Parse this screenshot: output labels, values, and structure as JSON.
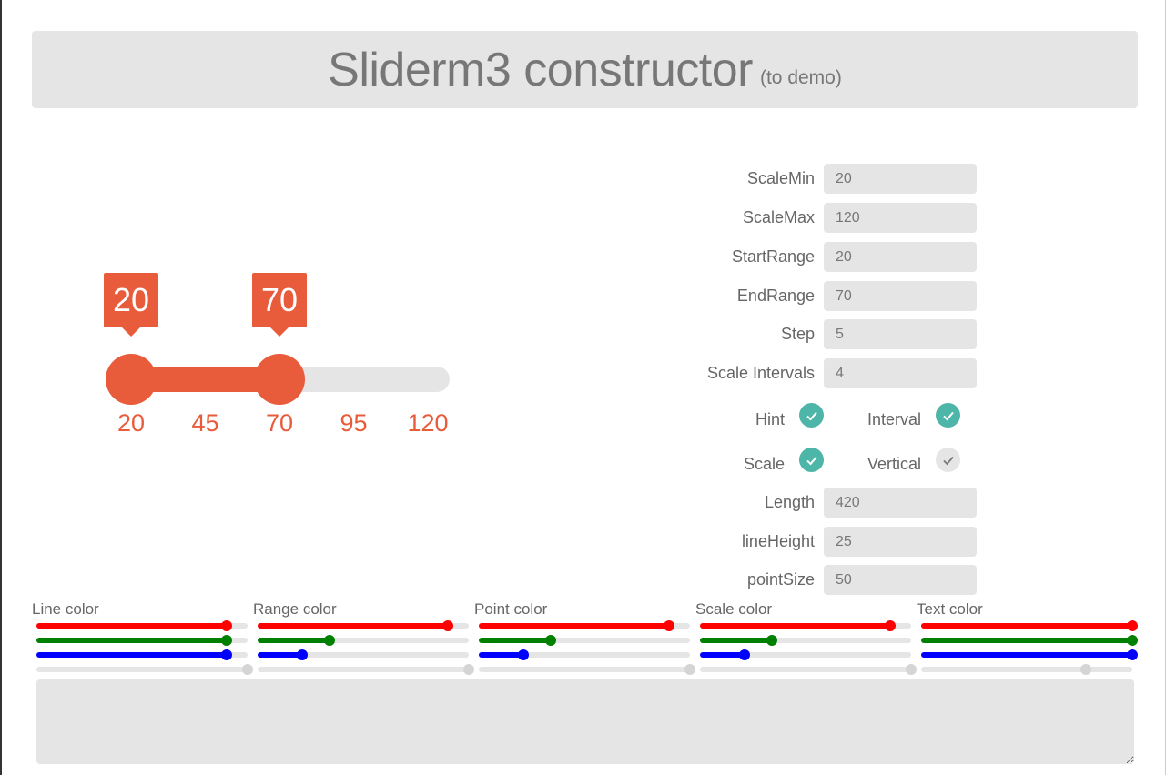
{
  "header": {
    "title": "Sliderm3 constructor",
    "subtitle": "(to demo)"
  },
  "slider": {
    "min": 20,
    "max": 120,
    "start_value": 20,
    "end_value": 70,
    "start_hint": "20",
    "end_hint": "70",
    "scale_labels": [
      "20",
      "45",
      "70",
      "95",
      "120"
    ],
    "accent_color": "#e85b3b",
    "track_color": "#e5e5e5"
  },
  "form": {
    "scale_min": {
      "label": "ScaleMin",
      "value": "20"
    },
    "scale_max": {
      "label": "ScaleMax",
      "value": "120"
    },
    "start_range": {
      "label": "StartRange",
      "value": "20"
    },
    "end_range": {
      "label": "EndRange",
      "value": "70"
    },
    "step": {
      "label": "Step",
      "value": "5"
    },
    "scale_intervals": {
      "label": "Scale Intervals",
      "value": "4"
    },
    "length": {
      "label": "Length",
      "value": "420"
    },
    "line_height": {
      "label": "lineHeight",
      "value": "25"
    },
    "point_size": {
      "label": "pointSize",
      "value": "50"
    }
  },
  "toggles": {
    "hint": {
      "label": "Hint",
      "checked": true
    },
    "interval": {
      "label": "Interval",
      "checked": true
    },
    "scale": {
      "label": "Scale",
      "checked": true
    },
    "vertical": {
      "label": "Vertical",
      "checked": false
    },
    "on_color": "#4db6a8",
    "off_color": "#e5e5e5"
  },
  "color_panels": {
    "line": {
      "label": "Line color",
      "r": 0.9,
      "g": 0.9,
      "b": 0.9,
      "a": 1.0
    },
    "range": {
      "label": "Range color",
      "r": 0.9,
      "g": 0.34,
      "b": 0.21,
      "a": 1.0
    },
    "point": {
      "label": "Point color",
      "r": 0.9,
      "g": 0.34,
      "b": 0.21,
      "a": 1.0
    },
    "scale": {
      "label": "Scale color",
      "r": 0.9,
      "g": 0.34,
      "b": 0.21,
      "a": 1.0
    },
    "text": {
      "label": "Text color",
      "r": 1.0,
      "g": 1.0,
      "b": 1.0,
      "a": 0.78
    }
  },
  "output": {
    "value": ""
  }
}
